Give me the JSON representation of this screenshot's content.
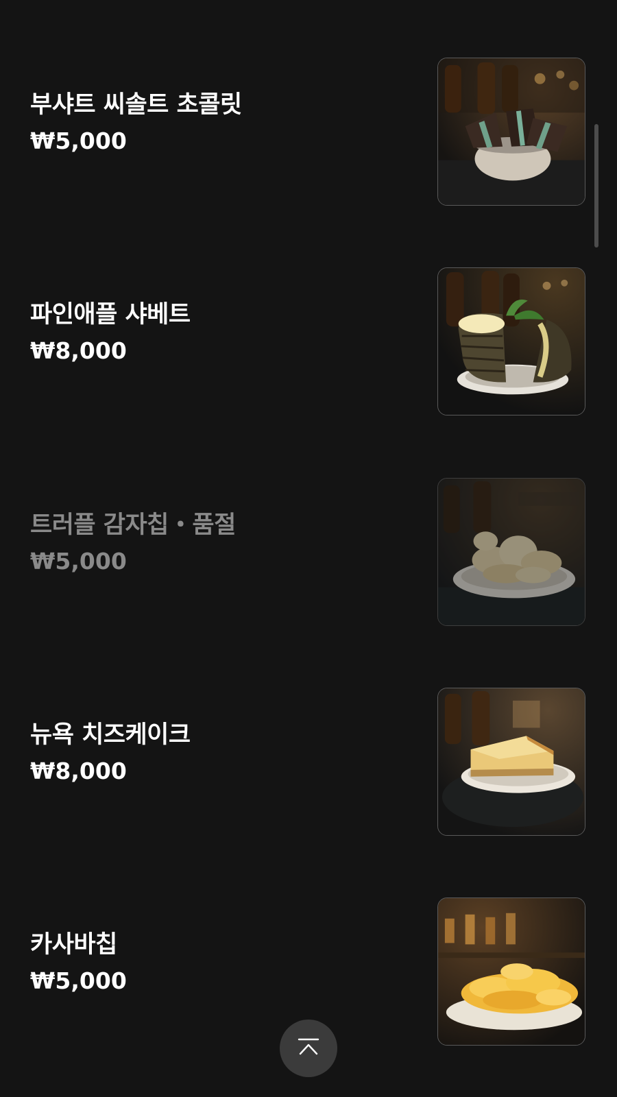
{
  "menu": {
    "items": [
      {
        "name": "부샤트 씨솔트 초콜릿",
        "price": "₩5,000",
        "sold_out": false,
        "image": "sea-salt-chocolate-photo"
      },
      {
        "name": "파인애플 샤베트",
        "price": "₩8,000",
        "sold_out": false,
        "image": "pineapple-sorbet-photo"
      },
      {
        "name": "트러플 감자칩・품절",
        "price": "₩5,000",
        "sold_out": true,
        "image": "truffle-potato-chips-photo"
      },
      {
        "name": "뉴욕 치즈케이크",
        "price": "₩8,000",
        "sold_out": false,
        "image": "new-york-cheesecake-photo"
      },
      {
        "name": "카사바칩",
        "price": "₩5,000",
        "sold_out": false,
        "image": "cassava-chips-photo"
      }
    ]
  },
  "scroll_top_button": {
    "icon": "chevron-up-bar-icon"
  },
  "colors": {
    "background": "#141414",
    "text": "#ffffff",
    "sold_out_text": "#8a8a8a",
    "button_bg": "#3b3b3b",
    "scrollbar": "#4c4c4c"
  }
}
